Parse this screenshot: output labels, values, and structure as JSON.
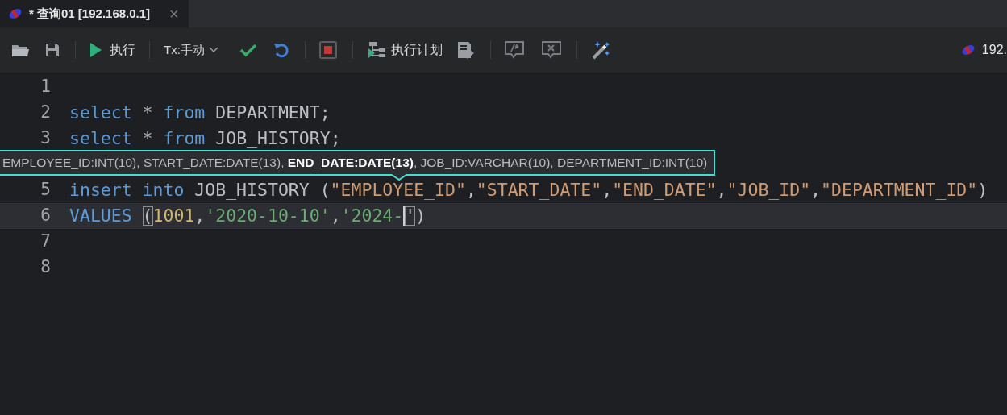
{
  "tab": {
    "title": "* 查询01 [192.168.0.1]",
    "close": "×",
    "selected": true
  },
  "toolbar": [
    {
      "kind": "folder"
    },
    {
      "kind": "save"
    },
    {
      "kind": "sep"
    },
    {
      "kind": "run",
      "label": "执行"
    },
    {
      "kind": "sep"
    },
    {
      "kind": "dropdown",
      "label": "Tx:手动"
    },
    {
      "kind": "commit"
    },
    {
      "kind": "rollback"
    },
    {
      "kind": "sep"
    },
    {
      "kind": "stop"
    },
    {
      "kind": "sep"
    },
    {
      "kind": "plan",
      "label": "执行计划"
    },
    {
      "kind": "runfile"
    },
    {
      "kind": "sep"
    },
    {
      "kind": "comment"
    },
    {
      "kind": "uncomment"
    },
    {
      "kind": "sep"
    },
    {
      "kind": "wand"
    }
  ],
  "connection": {
    "label": "192."
  },
  "editor": {
    "lines": [
      {
        "number": "1",
        "current": false
      },
      {
        "number": "2",
        "current": false,
        "tokens": [
          {
            "kind": "keyword",
            "text": "select"
          },
          {
            "kind": "plain",
            "text": " * "
          },
          {
            "kind": "keyword",
            "text": "from"
          },
          {
            "kind": "plain",
            "text": " DEPARTMENT;"
          }
        ]
      },
      {
        "number": "3",
        "current": false,
        "tokens": [
          {
            "kind": "keyword",
            "text": "select"
          },
          {
            "kind": "plain",
            "text": " * "
          },
          {
            "kind": "keyword",
            "text": "from"
          },
          {
            "kind": "plain",
            "text": " JOB_HISTORY;"
          }
        ]
      },
      {
        "current": false
      },
      {
        "number": "5",
        "current": false,
        "tokens": [
          {
            "kind": "keyword",
            "text": "insert into"
          },
          {
            "kind": "plain",
            "text": " JOB_HISTORY ("
          },
          {
            "kind": "ident",
            "text": "\"EMPLOYEE_ID\""
          },
          {
            "kind": "plain",
            "text": ","
          },
          {
            "kind": "ident",
            "text": "\"START_DATE\""
          },
          {
            "kind": "plain",
            "text": ","
          },
          {
            "kind": "ident",
            "text": "\"END_DATE\""
          },
          {
            "kind": "plain",
            "text": ","
          },
          {
            "kind": "ident",
            "text": "\"JOB_ID\""
          },
          {
            "kind": "plain",
            "text": ","
          },
          {
            "kind": "ident",
            "text": "\"DEPARTMENT_ID\""
          },
          {
            "kind": "plain",
            "text": ")"
          }
        ]
      },
      {
        "number": "6",
        "current": true,
        "tokens": [
          {
            "kind": "keyword",
            "text": "VALUES "
          },
          {
            "kind": "bracket",
            "text": "("
          },
          {
            "kind": "number",
            "text": "1001"
          },
          {
            "kind": "plain",
            "text": ","
          },
          {
            "kind": "string",
            "text": "'2020-10-10'"
          },
          {
            "kind": "plain",
            "text": ","
          },
          {
            "kind": "string",
            "text": "'2024-",
            "caret": true
          },
          {
            "kind": "bracket",
            "text": "'"
          },
          {
            "kind": "plain",
            "text": ")"
          }
        ]
      },
      {
        "number": "7",
        "current": false
      },
      {
        "number": "8",
        "current": false
      }
    ]
  },
  "tooltip": {
    "params": [
      {
        "text": "EMPLOYEE_ID:INT(10)",
        "current": false
      },
      {
        "text": "START_DATE:DATE(13)",
        "current": false
      },
      {
        "text": "END_DATE:DATE(13)",
        "current": true
      },
      {
        "text": "JOB_ID:VARCHAR(10)",
        "current": false
      },
      {
        "text": "DEPARTMENT_ID:INT(10)",
        "current": false
      }
    ],
    "separator": ", "
  }
}
